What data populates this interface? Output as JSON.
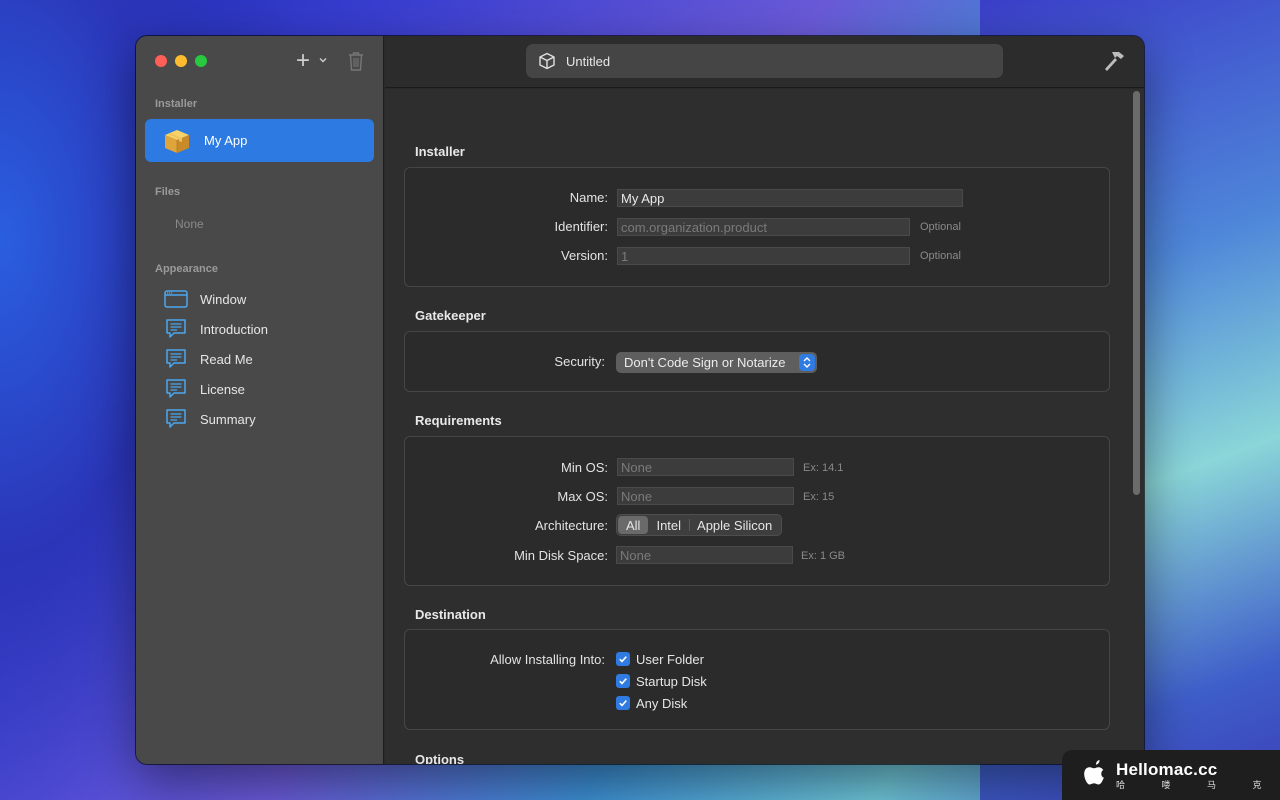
{
  "sidebar": {
    "installer_header": "Installer",
    "app_item": "My App",
    "files_header": "Files",
    "files_none": "None",
    "appearance_header": "Appearance",
    "appearance_items": [
      {
        "label": "Window",
        "icon": "window-icon"
      },
      {
        "label": "Introduction",
        "icon": "speech-bubble-icon"
      },
      {
        "label": "Read Me",
        "icon": "speech-bubble-icon"
      },
      {
        "label": "License",
        "icon": "speech-bubble-icon"
      },
      {
        "label": "Summary",
        "icon": "speech-bubble-icon"
      }
    ]
  },
  "toolbar": {
    "title": "Untitled",
    "add_label": "+",
    "add_icon": "plus-icon",
    "trash_icon": "trash-icon",
    "build_icon": "hammer-icon"
  },
  "installer": {
    "title": "Installer",
    "name_label": "Name:",
    "name_value": "My App",
    "identifier_label": "Identifier:",
    "identifier_placeholder": "com.organization.product",
    "identifier_hint": "Optional",
    "version_label": "Version:",
    "version_placeholder": "1",
    "version_hint": "Optional"
  },
  "gatekeeper": {
    "title": "Gatekeeper",
    "security_label": "Security:",
    "security_value": "Don't Code Sign or Notarize"
  },
  "requirements": {
    "title": "Requirements",
    "min_os_label": "Min OS:",
    "min_os_placeholder": "None",
    "min_os_hint": "Ex: 14.1",
    "max_os_label": "Max OS:",
    "max_os_placeholder": "None",
    "max_os_hint": "Ex: 15",
    "arch_label": "Architecture:",
    "arch_options": [
      "All",
      "Intel",
      "Apple Silicon"
    ],
    "arch_selected": "All",
    "disk_label": "Min Disk Space:",
    "disk_placeholder": "None",
    "disk_hint": "Ex: 1 GB"
  },
  "destination": {
    "title": "Destination",
    "allow_label": "Allow Installing Into:",
    "options": [
      {
        "label": "User Folder",
        "checked": true
      },
      {
        "label": "Startup Disk",
        "checked": true
      },
      {
        "label": "Any Disk",
        "checked": true
      }
    ]
  },
  "options": {
    "title": "Options"
  },
  "watermark": {
    "main": "Hellomac.cc",
    "sub": "哈 喽 马 克"
  },
  "colors": {
    "accent": "#2d7ae2",
    "sidebar_bg": "#494949",
    "content_bg": "#2e2e2e"
  }
}
